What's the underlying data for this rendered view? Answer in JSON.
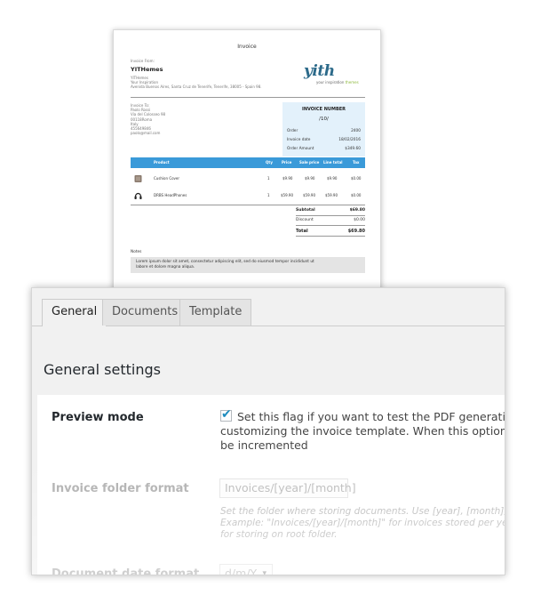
{
  "invoice": {
    "title": "Invoice",
    "from_label": "Invoice From:",
    "company_name": "YITHemes",
    "company_lines": [
      "YITHemes",
      "Your Inspiration",
      "Avenida Buenos Aires, Santa Cruz de Tenerife, Tenerife, 38005 - Spain 98."
    ],
    "logo_text": "yith",
    "logo_tag_main": "your inspiration",
    "logo_tag_accent": "themes",
    "to_lines": [
      "Invoice To:",
      "Paolo Rossi",
      "Via del Colosseo 98",
      "00118Roma",
      "Italy",
      "455649846",
      "paolo@mail.com"
    ],
    "number_title": "INVOICE NUMBER",
    "number_value": "/10/",
    "order_label": "Order",
    "order_value": "2400",
    "date_label": "Invoice date",
    "date_value": "18/02/2016",
    "amount_label": "Order Amount",
    "amount_value": "$349.60",
    "table_headers": {
      "product": "Product",
      "qty": "Qty",
      "price": "Price",
      "sale_price": "Sale price",
      "line_total": "Line total",
      "tax": "Tax"
    },
    "items": [
      {
        "name": "Cushion Cover",
        "qty": "1",
        "price": "$9.90",
        "sale_price": "$9.90",
        "line_total": "$9.90",
        "tax": "$0.00"
      },
      {
        "name": "DRBS HeadPhones",
        "qty": "1",
        "price": "$59.90",
        "sale_price": "$59.90",
        "line_total": "$59.90",
        "tax": "$0.00"
      }
    ],
    "subtotal_label": "Subtotal",
    "subtotal_value": "$69.80",
    "discount_label": "Discount",
    "discount_value": "$0.00",
    "total_label": "Total",
    "total_value": "$69.80",
    "notes_label": "Notes",
    "notes_line1": "Lorem ipsum dolor sit amet, consectetur adipiscing elit, sed do eiusmod tempor incididunt ut",
    "notes_line2": "labore et dolore magna aliqua."
  },
  "settings": {
    "tabs": [
      {
        "label": "General",
        "active": true
      },
      {
        "label": "Documents",
        "active": false
      },
      {
        "label": "Template",
        "active": false
      }
    ],
    "section_title": "General settings",
    "preview_mode": {
      "label": "Preview mode",
      "checked": true,
      "check_glyph": "✔",
      "desc_line1": "Set this flag if you want to test the PDF generation, for ex",
      "desc_line2": "customizing the invoice template. When this option is enabl",
      "desc_line3": "be incremented"
    },
    "folder_format": {
      "label": "Invoice folder format",
      "value": "Invoices/[year]/[month]",
      "hint_line1": "Set the folder where storing documents. Use [year], [month], [day] as",
      "hint_line2": "Example: \"Invoices/[year]/[month]\" for invoices stored per year and m",
      "hint_line3": "for storing on root folder."
    },
    "date_format": {
      "label": "Document date format",
      "value": "d/m/Y",
      "caret": "▾"
    }
  },
  "colors": {
    "accent_blue": "#3a9ad9",
    "invoice_box": "#e3f1fb",
    "checkbox_blue": "#1e8cbe"
  }
}
